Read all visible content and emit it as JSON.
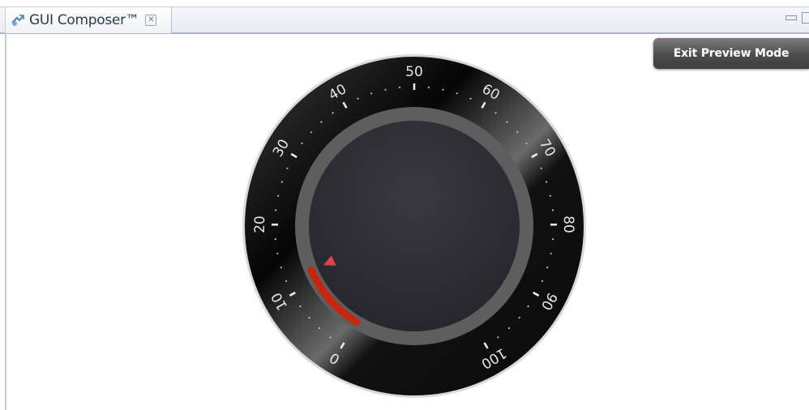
{
  "tab": {
    "title": "GUI Composer™",
    "icon": "gui-composer-icon",
    "close_icon": "close-icon"
  },
  "window_controls": {
    "minimize_icon": "minimize-icon",
    "maximize_icon": "maximize-icon"
  },
  "exit_button": {
    "label": "Exit Preview Mode"
  },
  "gauge": {
    "min": 0,
    "max": 100,
    "value": 12,
    "tick_labels": [
      "0",
      "10",
      "20",
      "30",
      "40",
      "50",
      "60",
      "70",
      "80",
      "90",
      "100"
    ],
    "colors": {
      "value_arc": "#c8250e",
      "indicator": "#e0404a",
      "bezel": "#0e0e0e",
      "face": "#2e2d33",
      "ring": "#5e5e5e"
    }
  }
}
